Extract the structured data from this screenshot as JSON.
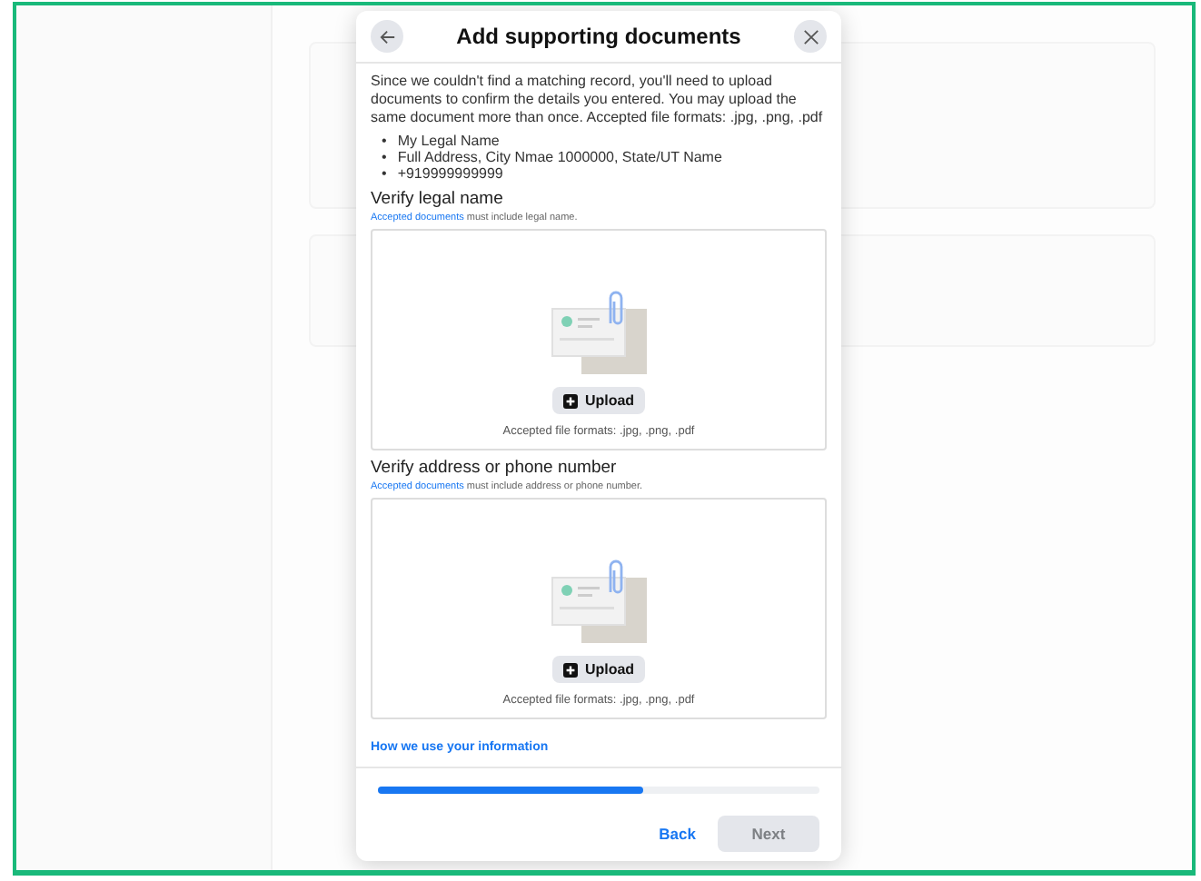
{
  "dialog": {
    "title": "Add supporting documents",
    "intro": "Since we couldn't find a matching record, you'll need to upload documents to confirm the details you entered. You may upload the same document more than once. Accepted file formats: .jpg, .png, .pdf",
    "bullets": [
      {
        "marker": "•",
        "text": "My Legal Name"
      },
      {
        "marker": "•",
        "text": "Full Address, City Nmae 1000000, State/UT Name"
      },
      {
        "marker": "•",
        "text": "+919999999999"
      }
    ],
    "sections": [
      {
        "heading": "Verify legal name",
        "link": "Accepted documents",
        "note": " must include legal name.",
        "upload_button": "Upload",
        "formats": "Accepted file formats: .jpg, .png, .pdf"
      },
      {
        "heading": "Verify address or phone number",
        "link": "Accepted documents",
        "note": " must include address or phone number.",
        "upload_button": "Upload",
        "formats": "Accepted file formats: .jpg, .png, .pdf"
      }
    ],
    "info_link": "How we use your information",
    "progress": {
      "level": 0.6
    },
    "buttons": [
      {
        "label": "Back",
        "kind": "link",
        "disabled": false
      },
      {
        "label": "Next",
        "kind": "primary",
        "disabled": true
      }
    ]
  }
}
